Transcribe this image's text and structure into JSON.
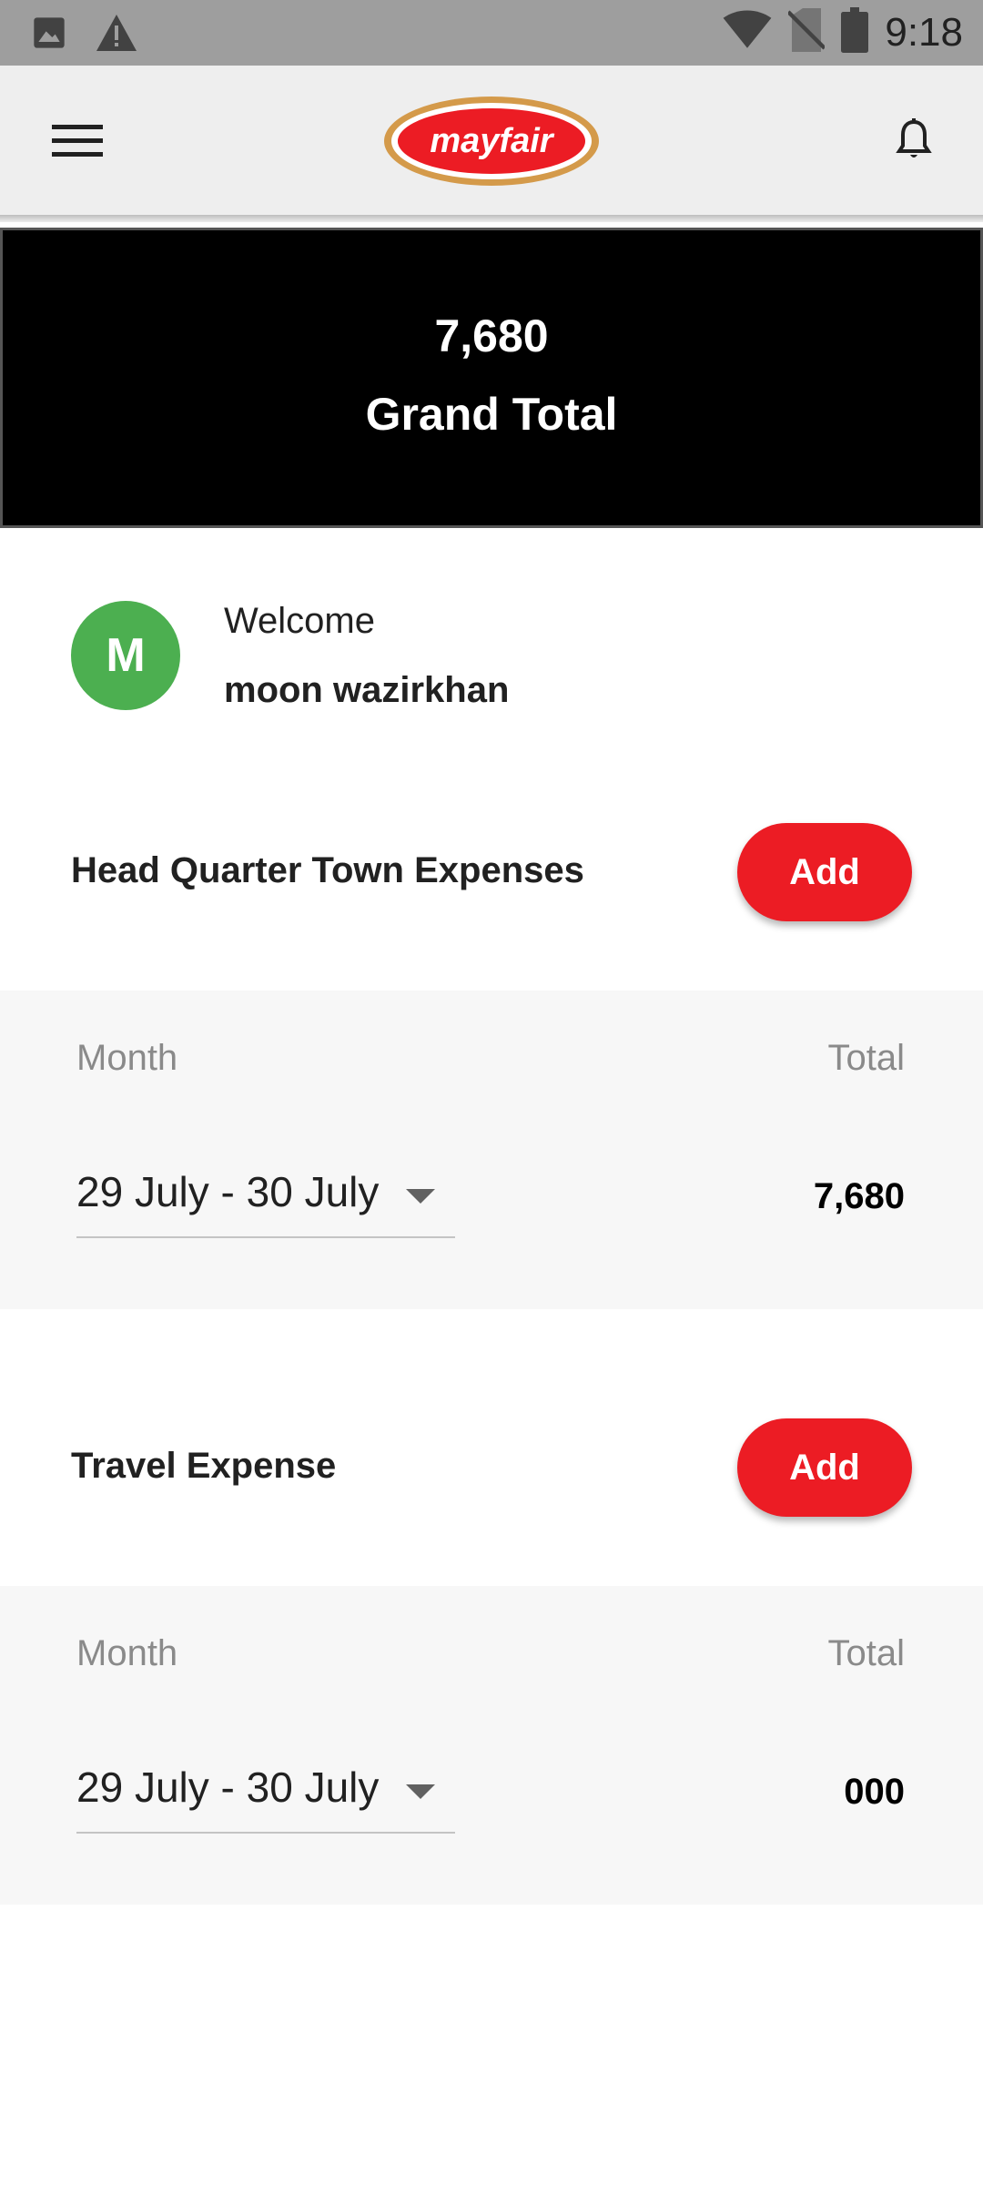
{
  "status_bar": {
    "time": "9:18",
    "icons": [
      "image-icon",
      "warning-icon",
      "wifi-icon",
      "no-sim-icon",
      "battery-icon"
    ]
  },
  "app_bar": {
    "logo_text": "mayfair",
    "menu_icon": "menu-icon",
    "notification_icon": "bell-icon"
  },
  "banner": {
    "value": "7,680",
    "label": "Grand Total"
  },
  "welcome": {
    "avatar_initial": "M",
    "greeting": "Welcome",
    "name": "moon wazirkhan"
  },
  "sections": [
    {
      "title": "Head Quarter Town Expenses",
      "add_label": "Add",
      "month_header": "Month",
      "total_header": "Total",
      "period": "29 July - 30 July",
      "total": "7,680"
    },
    {
      "title": "Travel Expense",
      "add_label": "Add",
      "month_header": "Month",
      "total_header": "Total",
      "period": "29 July - 30 July",
      "total": "000"
    }
  ],
  "colors": {
    "accent": "#ec1c24",
    "avatar": "#4caf50",
    "banner_bg": "#000000",
    "panel_bg": "#f7f7f7",
    "app_bar_bg": "#eeeeee",
    "logo_ring": "#d49a4a"
  }
}
